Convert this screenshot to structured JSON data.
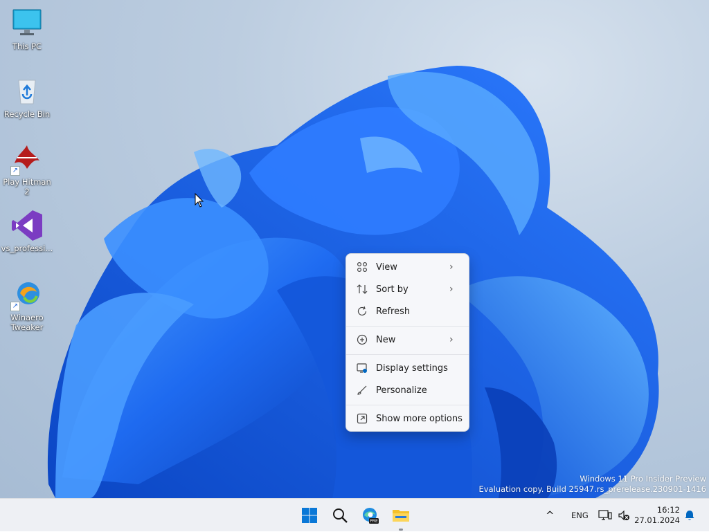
{
  "desktop": {
    "icons": [
      {
        "label": "This PC",
        "icon": "monitor-icon"
      },
      {
        "label": "Recycle Bin",
        "icon": "recycle-bin-icon"
      },
      {
        "label": "Play Hitman 2",
        "icon": "hitman-icon"
      },
      {
        "label": "vs_professi...",
        "icon": "visual-studio-icon"
      },
      {
        "label": "Winaero\nTweaker",
        "icon": "winaero-tweaker-icon"
      }
    ],
    "watermark": {
      "line1": "Windows 11 Pro Insider Preview",
      "line2": "Evaluation copy. Build 25947.rs_prerelease.230901-1416"
    }
  },
  "context_menu": {
    "items": [
      {
        "label": "View",
        "icon": "grid-icon",
        "submenu": true
      },
      {
        "label": "Sort by",
        "icon": "sort-icon",
        "submenu": true
      },
      {
        "label": "Refresh",
        "icon": "refresh-icon",
        "submenu": false
      },
      {
        "label": "New",
        "icon": "plus-circle-icon",
        "submenu": true
      },
      {
        "label": "Display settings",
        "icon": "display-settings-icon",
        "submenu": false
      },
      {
        "label": "Personalize",
        "icon": "brush-icon",
        "submenu": false
      },
      {
        "label": "Show more options",
        "icon": "open-external-icon",
        "submenu": false
      }
    ]
  },
  "taskbar": {
    "apps": [
      {
        "name": "Start",
        "icon": "windows-logo-icon"
      },
      {
        "name": "Search",
        "icon": "search-icon"
      },
      {
        "name": "Microsoft Edge Preview",
        "icon": "edge-preview-icon",
        "badge": "PRE"
      },
      {
        "name": "File Explorer",
        "icon": "folder-icon"
      }
    ],
    "tray": {
      "chevron": "^",
      "language": "ENG",
      "time": "16:12",
      "date": "27.01.2024"
    }
  },
  "colors": {
    "accent": "#0067c0",
    "bloom_dark": "#0a3fb8",
    "bloom_light": "#3a8bff"
  }
}
